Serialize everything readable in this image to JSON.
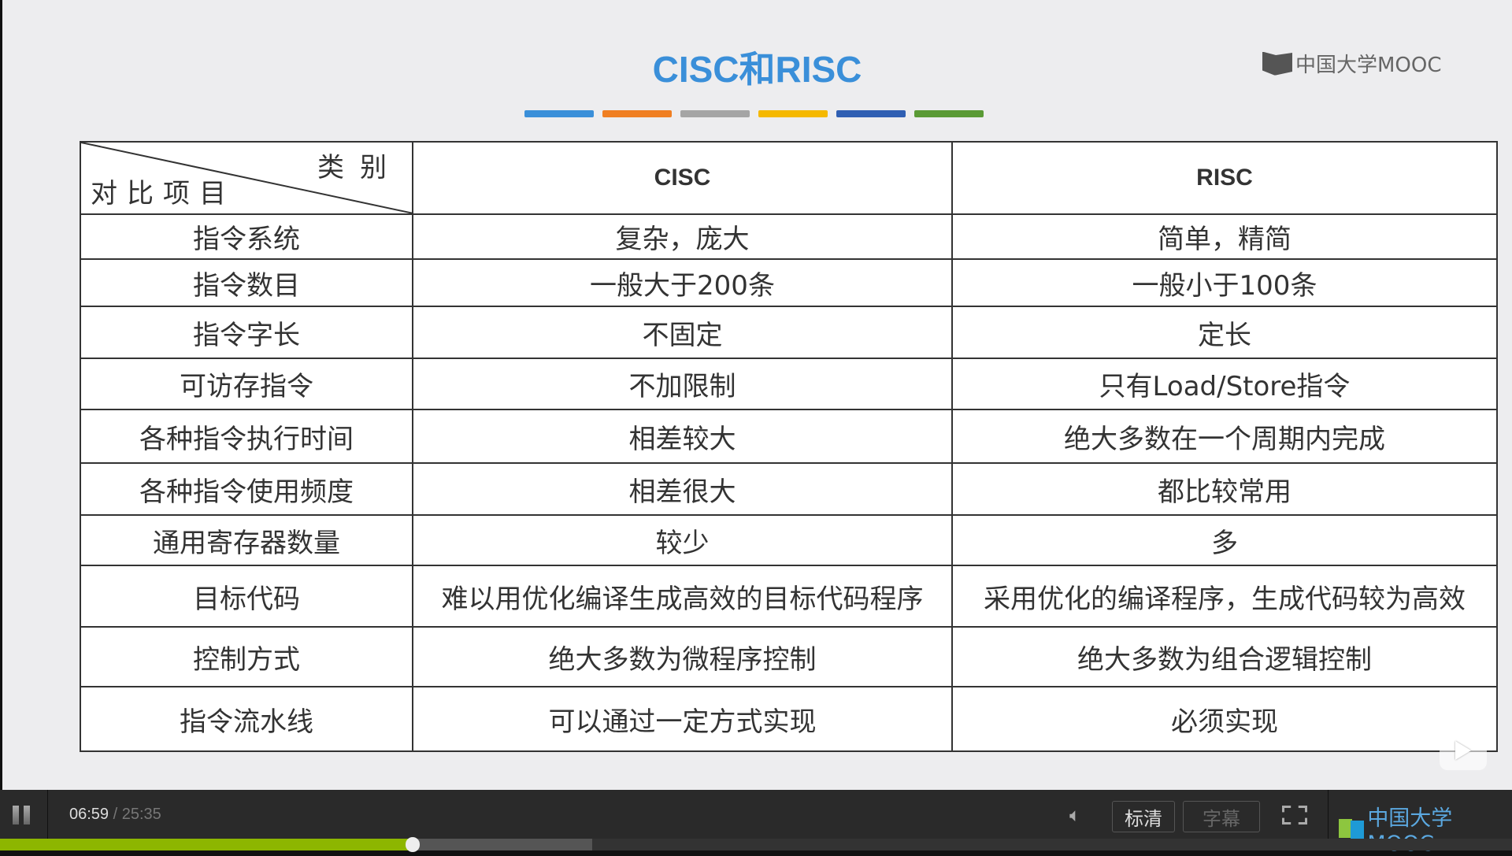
{
  "slide": {
    "title": "CISC和RISC",
    "brand": "中国大学MOOC",
    "bar_colors": [
      "#3a8fd9",
      "#f07f22",
      "#a5a5a5",
      "#f5b800",
      "#2f5fb3",
      "#5a9a35"
    ],
    "table": {
      "corner_top": "类别",
      "corner_bottom": "对比项目",
      "headers": [
        "CISC",
        "RISC"
      ],
      "rows": [
        [
          "指令系统",
          "复杂，庞大",
          "简单，精简"
        ],
        [
          "指令数目",
          "一般大于200条",
          "一般小于100条"
        ],
        [
          "指令字长",
          "不固定",
          "定长"
        ],
        [
          "可访存指令",
          "不加限制",
          "只有Load/Store指令"
        ],
        [
          "各种指令执行时间",
          "相差较大",
          "绝大多数在一个周期内完成"
        ],
        [
          "各种指令使用频度",
          "相差很大",
          "都比较常用"
        ],
        [
          "通用寄存器数量",
          "较少",
          "多"
        ],
        [
          "目标代码",
          "难以用优化编译生成高效的目标代码程序",
          "采用优化的编译程序，生成代码较为高效"
        ],
        [
          "控制方式",
          "绝大多数为微程序控制",
          "绝大多数为组合逻辑控制"
        ],
        [
          "指令流水线",
          "可以通过一定方式实现",
          "必须实现"
        ]
      ]
    }
  },
  "player": {
    "current_time": "06:59",
    "total_time": "/ 25:35",
    "quality": "标清",
    "subtitles": "字幕",
    "brand": "中国大学MOOC",
    "progress_fraction": 0.2731,
    "buffered_fraction": 0.3917,
    "progress_color": "#8db600"
  }
}
